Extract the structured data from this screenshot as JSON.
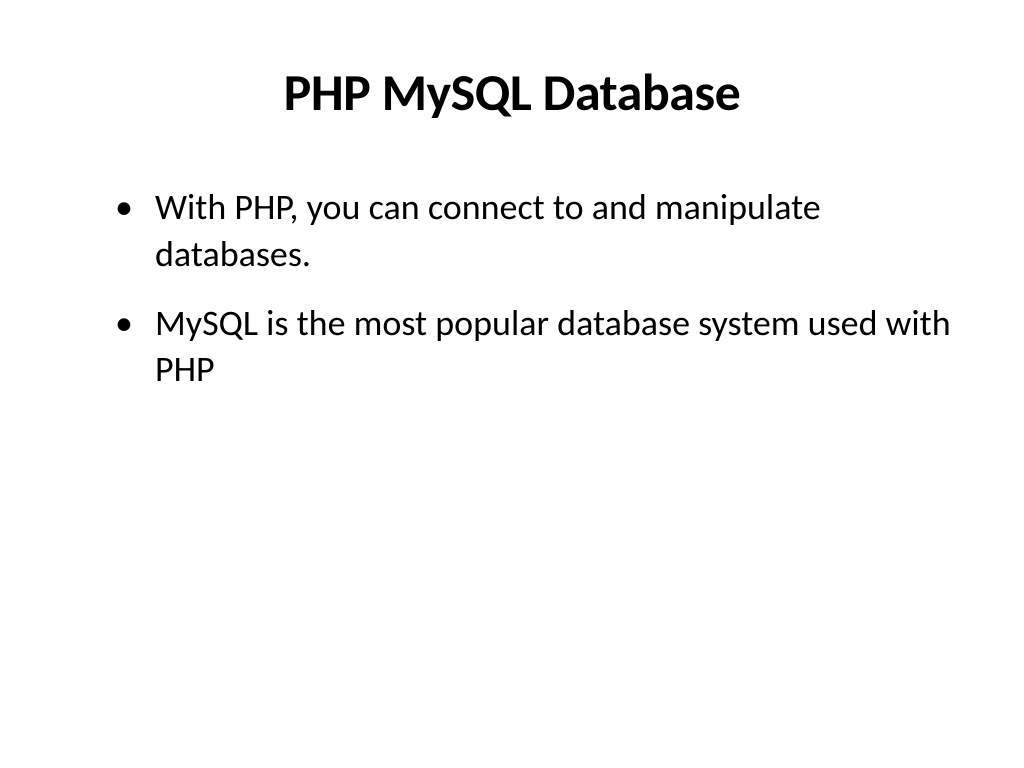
{
  "slide": {
    "title": "PHP MySQL Database",
    "bullets": [
      "With PHP, you can connect to and manipulate databases.",
      "MySQL is the most popular database system used with PHP"
    ]
  }
}
